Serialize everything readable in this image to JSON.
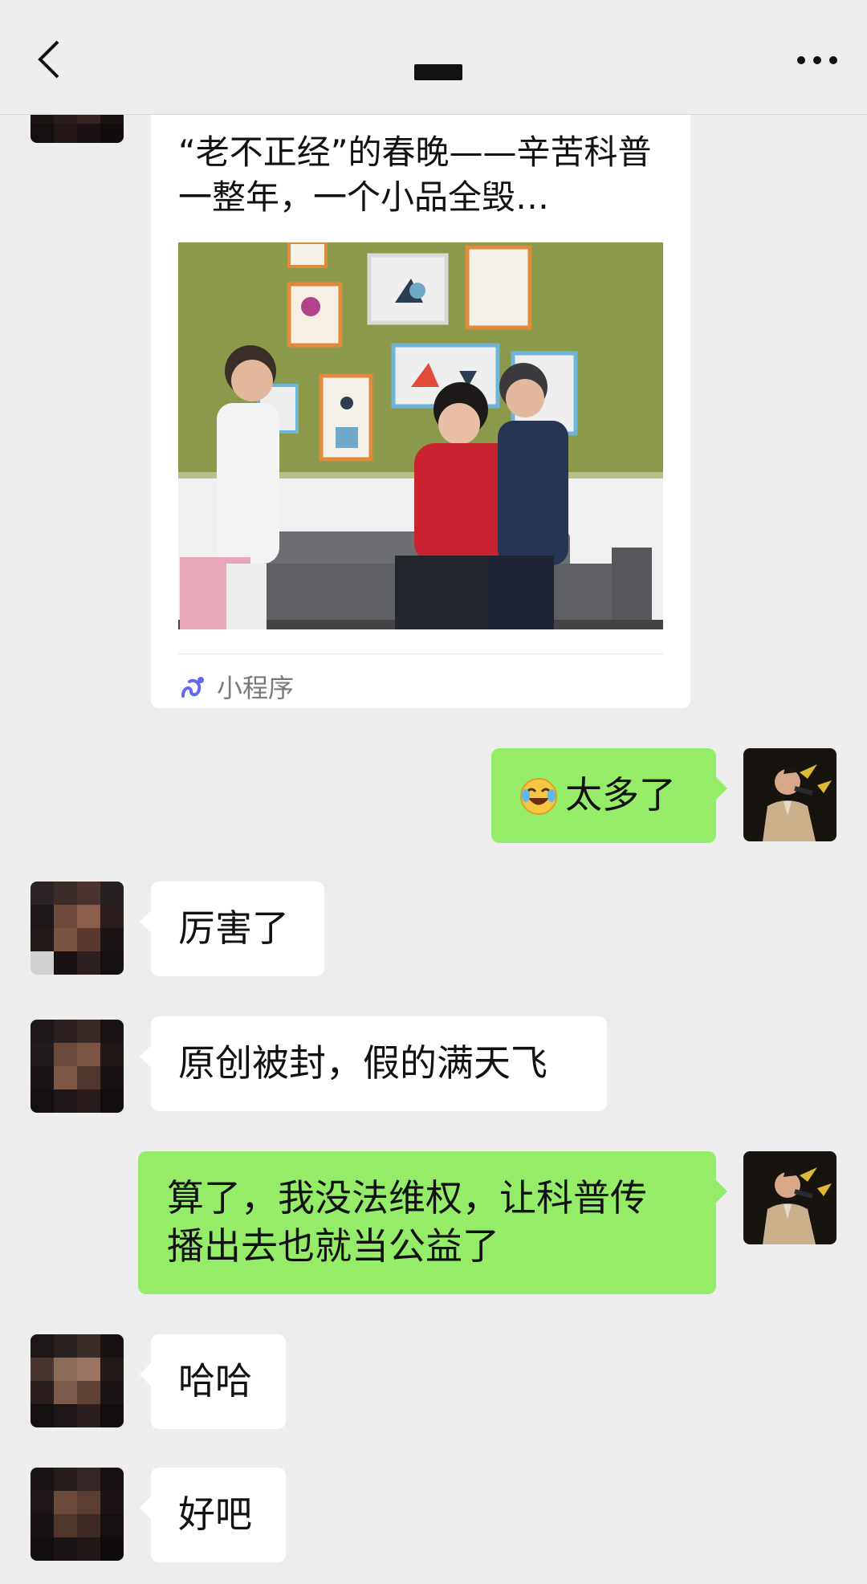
{
  "header": {
    "back_icon": "chevron-left-icon",
    "more_icon": "more-dots-icon"
  },
  "messages": [
    {
      "sender": "other",
      "type": "mini-program-card",
      "title": "“老不正经”的春晚——辛苦科普一整年，一个小品全毁…",
      "source_label": "小程序",
      "source_icon": "mini-program-icon"
    },
    {
      "sender": "me",
      "type": "text",
      "emoji": "face-with-tears-of-joy",
      "text": "太多了"
    },
    {
      "sender": "other",
      "type": "text",
      "text": "厉害了"
    },
    {
      "sender": "other",
      "type": "text",
      "text": "原创被封，假的满天飞"
    },
    {
      "sender": "me",
      "type": "text",
      "line1": "算了，我没法维权，让科普传",
      "line2": "播出去也就当公益了"
    },
    {
      "sender": "other",
      "type": "text",
      "text": "哈哈"
    },
    {
      "sender": "other",
      "type": "text",
      "text": "好吧"
    }
  ],
  "colors": {
    "background": "#EDEDED",
    "bubble_me": "#95EC69",
    "bubble_other": "#FFFFFF",
    "mini_program_icon": "#6467F0"
  }
}
